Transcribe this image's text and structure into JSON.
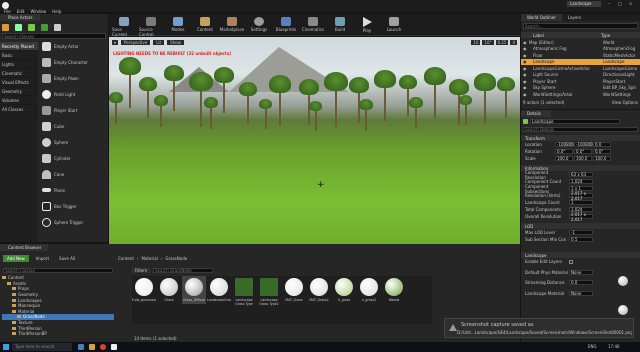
{
  "window": {
    "title": "Landscape"
  },
  "menu": [
    "File",
    "Edit",
    "Window",
    "Help"
  ],
  "modes_tab": "Place Actors",
  "search_placeholder": "Search Classes",
  "categories": [
    "Recently Placed",
    "Basic",
    "Lights",
    "Cinematic",
    "Visual Effects",
    "Geometry",
    "Volumes",
    "All Classes"
  ],
  "placed": [
    "Empty Actor",
    "Empty Character",
    "Empty Pawn",
    "Point Light",
    "Player Start",
    "Cube",
    "Sphere",
    "Cylinder",
    "Cone",
    "Plane",
    "Box Trigger",
    "Sphere Trigger"
  ],
  "toolbar": [
    "Save Current",
    "Source Control",
    "Modes",
    "Content",
    "Marketplace",
    "Settings",
    "Blueprints",
    "Cinematics",
    "Build",
    "Play",
    "Launch"
  ],
  "viewport": {
    "mode": "Perspective",
    "lit": "Lit",
    "show": "Show",
    "warning": "LIGHTING NEEDS TO BE REBUILT (22 unbuilt objects)",
    "numbers": [
      "10",
      "10°",
      "0.25",
      "4"
    ]
  },
  "world": {
    "tabs": [
      "World Outliner",
      "Layers"
    ],
    "search_placeholder": "Search...",
    "col_label": "Label",
    "col_type": "Type",
    "items": [
      {
        "label": "Map (Editor)",
        "type": "World"
      },
      {
        "label": "Atmospheric Fog",
        "type": "AtmosphericFog"
      },
      {
        "label": "Floor",
        "type": "StaticMeshActor"
      },
      {
        "label": "Landscape",
        "type": "Landscape"
      },
      {
        "label": "LandscapeGizmoActiveActor",
        "type": "LandscapeGizmo"
      },
      {
        "label": "Light Source",
        "type": "DirectionalLight"
      },
      {
        "label": "Player Start",
        "type": "PlayerStart"
      },
      {
        "label": "Sky Sphere",
        "type": "Edit BP_Sky_Sph"
      },
      {
        "label": "WorldSettings/Actor",
        "type": "WorldSettings"
      }
    ],
    "footer": "9 actors (1 selected)",
    "view_options": "View Options"
  },
  "details": {
    "tab": "Details",
    "name": "Landscape",
    "search_placeholder": "Search Details",
    "transform": {
      "title": "Transform",
      "location": [
        "Location",
        "-100800.0",
        "-100800.0",
        "0.0"
      ],
      "rotation": [
        "Rotation",
        "0.0°",
        "0.0°",
        "0.0°"
      ],
      "scale": [
        "Scale",
        "100.0",
        "100.0",
        "100.0"
      ]
    },
    "information": {
      "title": "Information",
      "rows": [
        [
          "Component Resolution",
          "63 x 63"
        ],
        [
          "Component Count",
          "1,024"
        ],
        [
          "Component Subsections",
          "1 x 1"
        ],
        [
          "Resolution (Verts)",
          "2,017 x 2,017"
        ],
        [
          "Landscape Count",
          "1"
        ],
        [
          "Total Components",
          "1,024"
        ],
        [
          "Overall Resolution",
          "2,017 x 2,017"
        ]
      ]
    },
    "lod": {
      "title": "LOD",
      "rows": [
        [
          "Max LOD Level",
          "-1"
        ],
        [
          "Sub Section Min Con",
          "0.5"
        ]
      ]
    },
    "landscape": {
      "title": "Landscape",
      "rows": [
        [
          "Enable Edit Layers",
          ""
        ],
        [
          "Default Phys Material",
          "None"
        ],
        [
          "Streaming Distance",
          "0.0"
        ],
        [
          "Landscape Material",
          "None"
        ]
      ]
    }
  },
  "content_browser": {
    "tab": "Content Browser",
    "add_new": "Add New",
    "import": "Import",
    "save_all": "Save All",
    "path": [
      "Content",
      "Material",
      "GrassNode"
    ],
    "filters": "Filters",
    "search_placeholder": "Search GrassNode",
    "folders": [
      "Content",
      "Assets",
      "Props",
      "Geometry",
      "Landscapes",
      "Mannequin",
      "Material",
      "GrassNode",
      "Texture",
      "ThirdPerson",
      "ThirdPersonBP"
    ],
    "assets": [
      "Fullo_grassnode",
      "Grass",
      "Grass_Diffuse",
      "LandscapeGrass_Node",
      "Landscape Grass Type",
      "Landscape Grass Type2",
      "MAT_Grass",
      "MAT_Grass2",
      "V_grass",
      "v_grass2",
      "Weeds"
    ],
    "footer": "14 items (1 selected)"
  },
  "notification": {
    "title": "Screenshot capture saved as",
    "path": "D:/Unit...Landscape/UE4/Landscape/Saved/Screenshots/Windows/ScreenShot00001.png"
  },
  "taskbar": {
    "search_placeholder": "Type here to search",
    "time": "17:46",
    "lang": "ENG"
  },
  "colors": {
    "accent": "#e8a33c",
    "selection": "#3e76b8",
    "grass": "#7bbf34"
  }
}
